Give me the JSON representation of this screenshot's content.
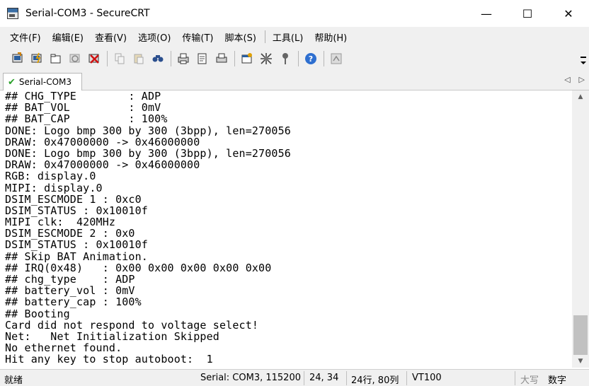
{
  "window": {
    "title": "Serial-COM3 - SecureCRT",
    "controls": {
      "minimize": "—",
      "maximize": "☐",
      "close": "✕"
    }
  },
  "menu": [
    {
      "label": "文件(F)"
    },
    {
      "label": "编辑(E)"
    },
    {
      "label": "查看(V)"
    },
    {
      "label": "选项(O)"
    },
    {
      "label": "传输(T)"
    },
    {
      "label": "脚本(S)"
    },
    {
      "label": "工具(L)"
    },
    {
      "label": "帮助(H)"
    }
  ],
  "toolbar": {
    "icons": [
      "connect-icon",
      "quick-connect-icon",
      "connect-in-tab-icon",
      "reconnect-icon",
      "disconnect-icon",
      "copy-icon",
      "paste-icon",
      "find-icon",
      "print-icon",
      "print-selection-icon",
      "print-screen-icon",
      "session-options-icon",
      "global-options-icon",
      "keymap-icon",
      "help-icon",
      "sftp-icon"
    ]
  },
  "tab": {
    "label": "Serial-COM3",
    "nav_left": "◁",
    "nav_right": "▷"
  },
  "terminal": {
    "lines": [
      "## CHG_TYPE        : ADP",
      "## BAT_VOL         : 0mV",
      "## BAT_CAP         : 100%",
      "DONE: Logo bmp 300 by 300 (3bpp), len=270056",
      "DRAW: 0x47000000 -> 0x46000000",
      "DONE: Logo bmp 300 by 300 (3bpp), len=270056",
      "DRAW: 0x47000000 -> 0x46000000",
      "RGB: display.0",
      "MIPI: display.0",
      "DSIM_ESCMODE 1 : 0xc0",
      "DSIM_STATUS : 0x10010f",
      "MIPI clk:  420MHz",
      "DSIM_ESCMODE 2 : 0x0",
      "DSIM_STATUS : 0x10010f",
      "## Skip BAT Animation.",
      "## IRQ(0x48)   : 0x00 0x00 0x00 0x00 0x00",
      "## chg_type    : ADP",
      "## battery_vol : 0mV",
      "## battery_cap : 100%",
      "## Booting",
      "Card did not respond to voltage select!",
      "Net:   Net Initialization Skipped",
      "No ethernet found.",
      "Hit any key to stop autoboot:  1"
    ]
  },
  "statusbar": {
    "ready": "就绪",
    "connection": "Serial: COM3, 115200",
    "cursor": "24,  34",
    "size": "24行, 80列",
    "emulation": "VT100",
    "caps": "大写",
    "num": "数字"
  }
}
